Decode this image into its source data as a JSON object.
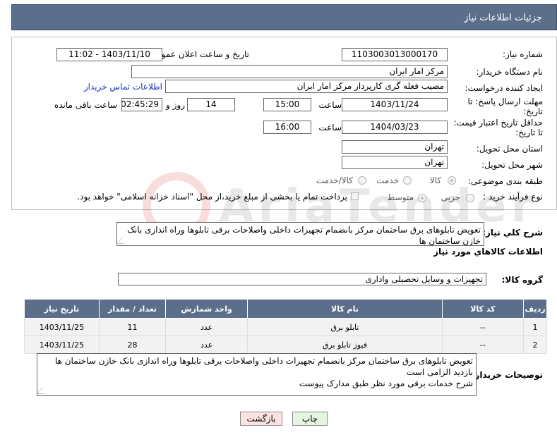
{
  "header": {
    "title": "جزئیات اطلاعات نیاز"
  },
  "form": {
    "need_number_label": "شماره نیاز:",
    "need_number": "1103003013000170",
    "announce_label": "تاریخ و ساعت اعلان عمومی:",
    "announce_value": "1403/11/10 - 11:02",
    "buyer_org_label": "نام دستگاه خریدار:",
    "buyer_org": "مرکز امار ایران",
    "requester_label": "ایجاد کننده درخواست:",
    "requester": "مصیب فعله گری کارپرداز مرکز امار ایران",
    "contact_link": "اطلاعات تماس خریدار",
    "deadline_label": "مهلت ارسال پاسخ: تا تاریخ:",
    "deadline_date": "1403/11/24",
    "time_label": "ساعت",
    "deadline_time": "15:00",
    "days": "14",
    "days_and_label": "روز و",
    "remaining_time": "02:45:29",
    "remaining_label": "ساعت باقی مانده",
    "price_validity_label": "حداقل تاریخ اعتبار قیمت: تا تاریخ:",
    "price_validity_date": "1404/03/23",
    "price_validity_time": "16:00",
    "province_label": "استان محل تحویل:",
    "province": "تهران",
    "city_label": "شهر محل تحویل:",
    "city": "تهران",
    "category_label": "طبقه بندی موضوعی:",
    "category_options": [
      "کالا",
      "خدمت",
      "کالا/خدمت"
    ],
    "process_label": "نوع فرآیند خرید :",
    "process_options": [
      "جزیی",
      "متوسط"
    ],
    "payment_note": "پرداخت تمام یا بخشی از مبلغ خرید،از محل \"اسناد خزانه اسلامی\" خواهد بود."
  },
  "summary": {
    "label": "شرح كلي نياز:",
    "text": "تعویض تابلوهای برق ساختمان مرکز بانضمام تجهیزات داخلی واصلاحات برقی تابلوها وراه اندازی بانک خازن ساختمان ها"
  },
  "goods_info": {
    "title": "اطلاعات كالاهاي مورد نياز",
    "group_label": "گروه کالا:",
    "group_value": "تجهیزات و وسایل تحصیلی واداری"
  },
  "table": {
    "headers": [
      "ردیف",
      "کد کالا",
      "نام کالا",
      "واحد شمارش",
      "تعداد / مقدار",
      "تاریخ نیاز"
    ],
    "rows": [
      [
        "1",
        "--",
        "تابلو برق",
        "عدد",
        "11",
        "1403/11/25"
      ],
      [
        "2",
        "--",
        "فیوز تابلو برق",
        "عدد",
        "28",
        "1403/11/25"
      ]
    ]
  },
  "buyer_notes": {
    "label": "توضیحات خریدار:",
    "lines": [
      "تعویض تابلوهای برق ساختمان مرکز بانضمام تجهیزات داخلی واصلاحات برقی تابلوها وراه اندازی بانک خازن ساختمان ها",
      "بازدید الزامی است",
      "شرح خدمات برقی مورد نظر طبق مدارک پیوست"
    ]
  },
  "buttons": {
    "print": "چاپ",
    "back": "بازگشت"
  },
  "colors": {
    "header_bg": "#5b6e8a",
    "link": "#1a33c8",
    "back_btn_bg": "#fde2e2",
    "print_btn_bg": "#e4f5e0"
  }
}
